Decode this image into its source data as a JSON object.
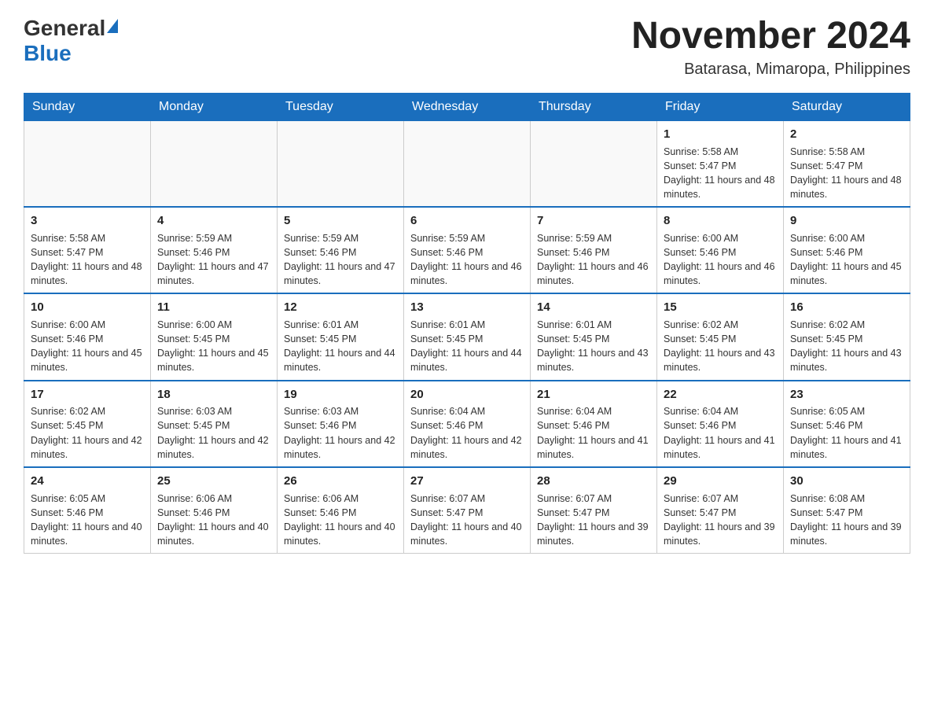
{
  "header": {
    "logo_general": "General",
    "logo_blue": "Blue",
    "month_title": "November 2024",
    "location": "Batarasa, Mimaropa, Philippines"
  },
  "days_of_week": [
    "Sunday",
    "Monday",
    "Tuesday",
    "Wednesday",
    "Thursday",
    "Friday",
    "Saturday"
  ],
  "weeks": [
    [
      {
        "day": "",
        "sunrise": "",
        "sunset": "",
        "daylight": "",
        "empty": true
      },
      {
        "day": "",
        "sunrise": "",
        "sunset": "",
        "daylight": "",
        "empty": true
      },
      {
        "day": "",
        "sunrise": "",
        "sunset": "",
        "daylight": "",
        "empty": true
      },
      {
        "day": "",
        "sunrise": "",
        "sunset": "",
        "daylight": "",
        "empty": true
      },
      {
        "day": "",
        "sunrise": "",
        "sunset": "",
        "daylight": "",
        "empty": true
      },
      {
        "day": "1",
        "sunrise": "Sunrise: 5:58 AM",
        "sunset": "Sunset: 5:47 PM",
        "daylight": "Daylight: 11 hours and 48 minutes.",
        "empty": false
      },
      {
        "day": "2",
        "sunrise": "Sunrise: 5:58 AM",
        "sunset": "Sunset: 5:47 PM",
        "daylight": "Daylight: 11 hours and 48 minutes.",
        "empty": false
      }
    ],
    [
      {
        "day": "3",
        "sunrise": "Sunrise: 5:58 AM",
        "sunset": "Sunset: 5:47 PM",
        "daylight": "Daylight: 11 hours and 48 minutes.",
        "empty": false
      },
      {
        "day": "4",
        "sunrise": "Sunrise: 5:59 AM",
        "sunset": "Sunset: 5:46 PM",
        "daylight": "Daylight: 11 hours and 47 minutes.",
        "empty": false
      },
      {
        "day": "5",
        "sunrise": "Sunrise: 5:59 AM",
        "sunset": "Sunset: 5:46 PM",
        "daylight": "Daylight: 11 hours and 47 minutes.",
        "empty": false
      },
      {
        "day": "6",
        "sunrise": "Sunrise: 5:59 AM",
        "sunset": "Sunset: 5:46 PM",
        "daylight": "Daylight: 11 hours and 46 minutes.",
        "empty": false
      },
      {
        "day": "7",
        "sunrise": "Sunrise: 5:59 AM",
        "sunset": "Sunset: 5:46 PM",
        "daylight": "Daylight: 11 hours and 46 minutes.",
        "empty": false
      },
      {
        "day": "8",
        "sunrise": "Sunrise: 6:00 AM",
        "sunset": "Sunset: 5:46 PM",
        "daylight": "Daylight: 11 hours and 46 minutes.",
        "empty": false
      },
      {
        "day": "9",
        "sunrise": "Sunrise: 6:00 AM",
        "sunset": "Sunset: 5:46 PM",
        "daylight": "Daylight: 11 hours and 45 minutes.",
        "empty": false
      }
    ],
    [
      {
        "day": "10",
        "sunrise": "Sunrise: 6:00 AM",
        "sunset": "Sunset: 5:46 PM",
        "daylight": "Daylight: 11 hours and 45 minutes.",
        "empty": false
      },
      {
        "day": "11",
        "sunrise": "Sunrise: 6:00 AM",
        "sunset": "Sunset: 5:45 PM",
        "daylight": "Daylight: 11 hours and 45 minutes.",
        "empty": false
      },
      {
        "day": "12",
        "sunrise": "Sunrise: 6:01 AM",
        "sunset": "Sunset: 5:45 PM",
        "daylight": "Daylight: 11 hours and 44 minutes.",
        "empty": false
      },
      {
        "day": "13",
        "sunrise": "Sunrise: 6:01 AM",
        "sunset": "Sunset: 5:45 PM",
        "daylight": "Daylight: 11 hours and 44 minutes.",
        "empty": false
      },
      {
        "day": "14",
        "sunrise": "Sunrise: 6:01 AM",
        "sunset": "Sunset: 5:45 PM",
        "daylight": "Daylight: 11 hours and 43 minutes.",
        "empty": false
      },
      {
        "day": "15",
        "sunrise": "Sunrise: 6:02 AM",
        "sunset": "Sunset: 5:45 PM",
        "daylight": "Daylight: 11 hours and 43 minutes.",
        "empty": false
      },
      {
        "day": "16",
        "sunrise": "Sunrise: 6:02 AM",
        "sunset": "Sunset: 5:45 PM",
        "daylight": "Daylight: 11 hours and 43 minutes.",
        "empty": false
      }
    ],
    [
      {
        "day": "17",
        "sunrise": "Sunrise: 6:02 AM",
        "sunset": "Sunset: 5:45 PM",
        "daylight": "Daylight: 11 hours and 42 minutes.",
        "empty": false
      },
      {
        "day": "18",
        "sunrise": "Sunrise: 6:03 AM",
        "sunset": "Sunset: 5:45 PM",
        "daylight": "Daylight: 11 hours and 42 minutes.",
        "empty": false
      },
      {
        "day": "19",
        "sunrise": "Sunrise: 6:03 AM",
        "sunset": "Sunset: 5:46 PM",
        "daylight": "Daylight: 11 hours and 42 minutes.",
        "empty": false
      },
      {
        "day": "20",
        "sunrise": "Sunrise: 6:04 AM",
        "sunset": "Sunset: 5:46 PM",
        "daylight": "Daylight: 11 hours and 42 minutes.",
        "empty": false
      },
      {
        "day": "21",
        "sunrise": "Sunrise: 6:04 AM",
        "sunset": "Sunset: 5:46 PM",
        "daylight": "Daylight: 11 hours and 41 minutes.",
        "empty": false
      },
      {
        "day": "22",
        "sunrise": "Sunrise: 6:04 AM",
        "sunset": "Sunset: 5:46 PM",
        "daylight": "Daylight: 11 hours and 41 minutes.",
        "empty": false
      },
      {
        "day": "23",
        "sunrise": "Sunrise: 6:05 AM",
        "sunset": "Sunset: 5:46 PM",
        "daylight": "Daylight: 11 hours and 41 minutes.",
        "empty": false
      }
    ],
    [
      {
        "day": "24",
        "sunrise": "Sunrise: 6:05 AM",
        "sunset": "Sunset: 5:46 PM",
        "daylight": "Daylight: 11 hours and 40 minutes.",
        "empty": false
      },
      {
        "day": "25",
        "sunrise": "Sunrise: 6:06 AM",
        "sunset": "Sunset: 5:46 PM",
        "daylight": "Daylight: 11 hours and 40 minutes.",
        "empty": false
      },
      {
        "day": "26",
        "sunrise": "Sunrise: 6:06 AM",
        "sunset": "Sunset: 5:46 PM",
        "daylight": "Daylight: 11 hours and 40 minutes.",
        "empty": false
      },
      {
        "day": "27",
        "sunrise": "Sunrise: 6:07 AM",
        "sunset": "Sunset: 5:47 PM",
        "daylight": "Daylight: 11 hours and 40 minutes.",
        "empty": false
      },
      {
        "day": "28",
        "sunrise": "Sunrise: 6:07 AM",
        "sunset": "Sunset: 5:47 PM",
        "daylight": "Daylight: 11 hours and 39 minutes.",
        "empty": false
      },
      {
        "day": "29",
        "sunrise": "Sunrise: 6:07 AM",
        "sunset": "Sunset: 5:47 PM",
        "daylight": "Daylight: 11 hours and 39 minutes.",
        "empty": false
      },
      {
        "day": "30",
        "sunrise": "Sunrise: 6:08 AM",
        "sunset": "Sunset: 5:47 PM",
        "daylight": "Daylight: 11 hours and 39 minutes.",
        "empty": false
      }
    ]
  ]
}
